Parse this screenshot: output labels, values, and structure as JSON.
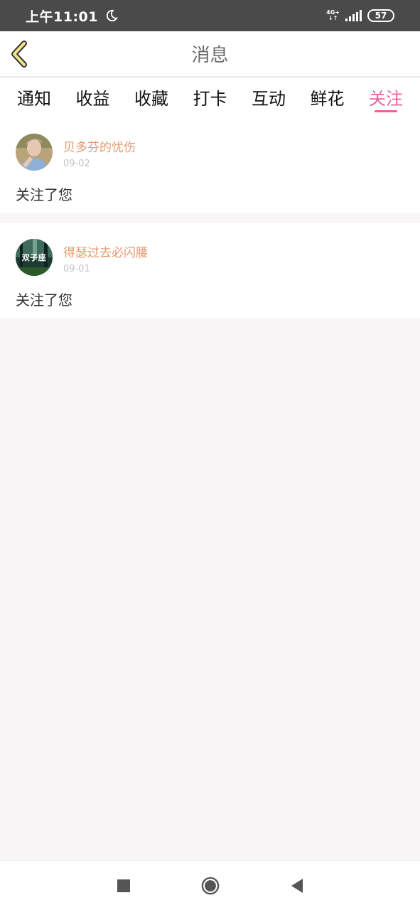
{
  "status_bar": {
    "time": "上午11:01",
    "network": "4G+",
    "network_sub": "↓↑",
    "battery": "57"
  },
  "header": {
    "title": "消息",
    "back_icon": "chevron-left-icon"
  },
  "tabs": [
    {
      "label": "通知",
      "active": false
    },
    {
      "label": "收益",
      "active": false
    },
    {
      "label": "收藏",
      "active": false
    },
    {
      "label": "打卡",
      "active": false
    },
    {
      "label": "互动",
      "active": false
    },
    {
      "label": "鲜花",
      "active": false
    },
    {
      "label": "关注",
      "active": true
    }
  ],
  "notifications": [
    {
      "username": "贝多芬的忧伤",
      "date": "09-02",
      "action": "关注了您"
    },
    {
      "username": "得瑟过去必闪腰",
      "date": "09-01",
      "action": "关注了您",
      "avatar_text": "双子座"
    }
  ],
  "colors": {
    "accent": "#e8639b",
    "username": "#e49a6f",
    "status_bar": "#4a4a4a",
    "page_bg": "#f8f6f7"
  }
}
